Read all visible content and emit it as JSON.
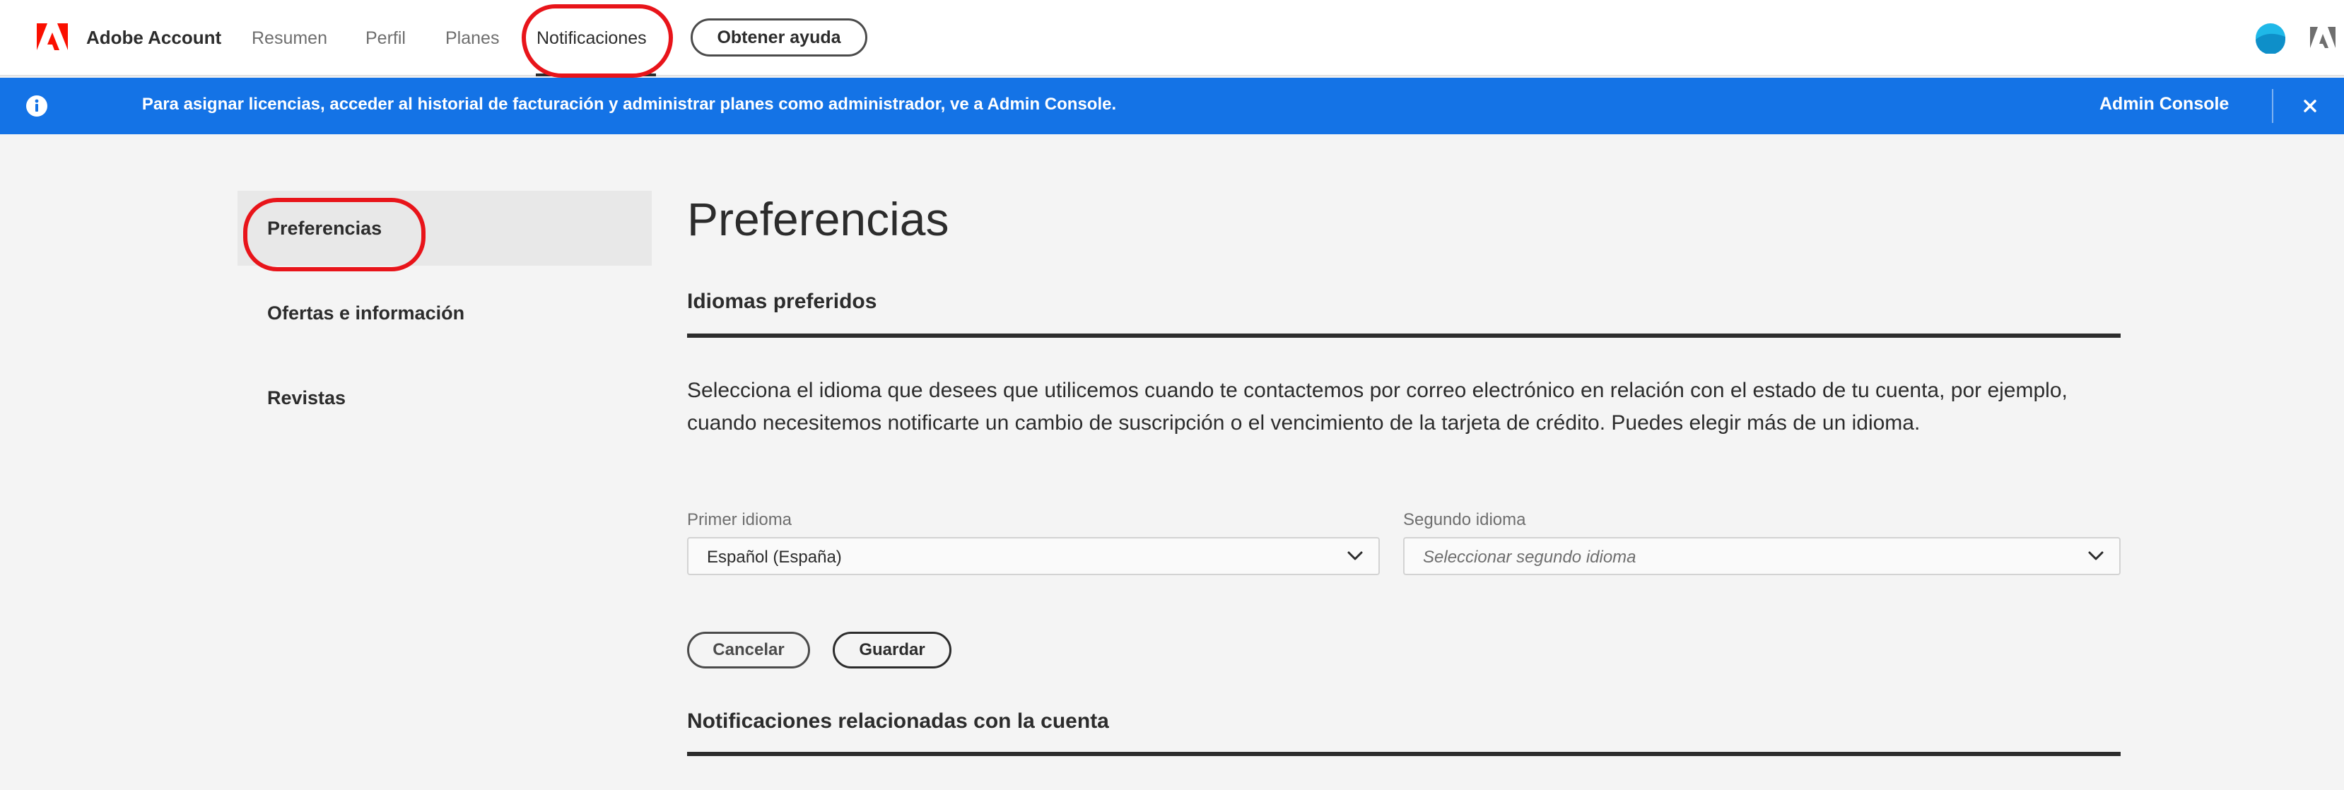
{
  "app": {
    "brand_name": "Adobe Account",
    "brand_logo": "adobe-logo-icon"
  },
  "nav": {
    "items": [
      {
        "label": "Resumen",
        "active": false
      },
      {
        "label": "Perfil",
        "active": false
      },
      {
        "label": "Planes",
        "active": false
      },
      {
        "label": "Notificaciones",
        "active": true
      }
    ],
    "help_button": "Obtener ayuda"
  },
  "banner": {
    "icon": "info-icon",
    "text": "Para asignar licencias, acceder al historial de facturación y administrar planes como administrador, ve a Admin Console.",
    "link": "Admin Console",
    "close_icon": "close-icon",
    "color": "#1473e6"
  },
  "sidebar": {
    "items": [
      {
        "label": "Preferencias",
        "selected": true
      },
      {
        "label": "Ofertas e información",
        "selected": false
      },
      {
        "label": "Revistas",
        "selected": false
      }
    ]
  },
  "main": {
    "title": "Preferencias",
    "section_languages": {
      "heading": "Idiomas preferidos",
      "description": "Selecciona el idioma que desees que utilicemos cuando te contactemos por correo electrónico en relación con el estado de tu cuenta, por ejemplo, cuando necesitemos notificarte un cambio de suscripción o el vencimiento de la tarjeta de crédito. Puedes elegir más de un idioma.",
      "first_language": {
        "label": "Primer idioma",
        "value": "Español (España)"
      },
      "second_language": {
        "label": "Segundo idioma",
        "placeholder": "Seleccionar segundo idioma"
      },
      "cancel_label": "Cancelar",
      "save_label": "Guardar"
    },
    "section_account": {
      "heading": "Notificaciones relacionadas con la cuenta"
    }
  },
  "colors": {
    "accent": "#1473e6",
    "annotation": "#e8141a",
    "brand": "#fa0f00"
  }
}
